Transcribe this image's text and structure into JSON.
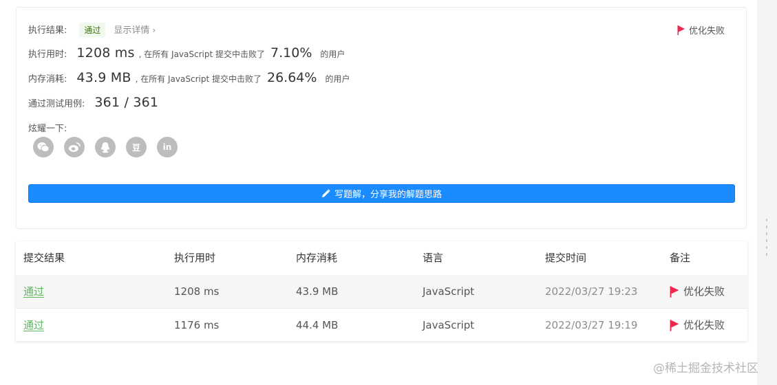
{
  "result": {
    "label_result": "执行结果:",
    "status_badge": "通过",
    "detail_link": "显示详情",
    "detail_chevron": "›",
    "optimize_failed": "优化失败",
    "runtime": {
      "label": "执行用时:",
      "value": "1208 ms",
      "mid_text": ", 在所有 JavaScript 提交中击败了",
      "percent": "7.10%",
      "suffix": "的用户"
    },
    "memory": {
      "label": "内存消耗:",
      "value": "43.9 MB",
      "mid_text": ", 在所有 JavaScript 提交中击败了",
      "percent": "26.64%",
      "suffix": "的用户"
    },
    "testcases": {
      "label": "通过测试用例:",
      "value": "361 / 361"
    },
    "share_label": "炫耀一下:",
    "share_icons": [
      "wechat-icon",
      "weibo-icon",
      "qq-icon",
      "douban-icon",
      "linkedin-icon"
    ],
    "share_glyphs": {
      "douban": "豆",
      "linkedin": "in"
    },
    "write_button": "写题解，分享我的解题思路"
  },
  "table": {
    "headers": [
      "提交结果",
      "执行用时",
      "内存消耗",
      "语言",
      "提交时间",
      "备注"
    ],
    "rows": [
      {
        "status": "通过",
        "runtime": "1208 ms",
        "memory": "43.9 MB",
        "language": "JavaScript",
        "time": "2022/03/27 19:23",
        "note": "优化失败"
      },
      {
        "status": "通过",
        "runtime": "1176 ms",
        "memory": "44.4 MB",
        "language": "JavaScript",
        "time": "2022/03/27 19:19",
        "note": "优化失败"
      }
    ]
  },
  "watermark": "@稀土掘金技术社区",
  "colors": {
    "accent_blue": "#1a8cff",
    "pass_green": "#5cb85c",
    "flag_red": "#f0264d",
    "badge_bg": "#f0f9eb",
    "icon_gray": "#bdbdbd"
  }
}
